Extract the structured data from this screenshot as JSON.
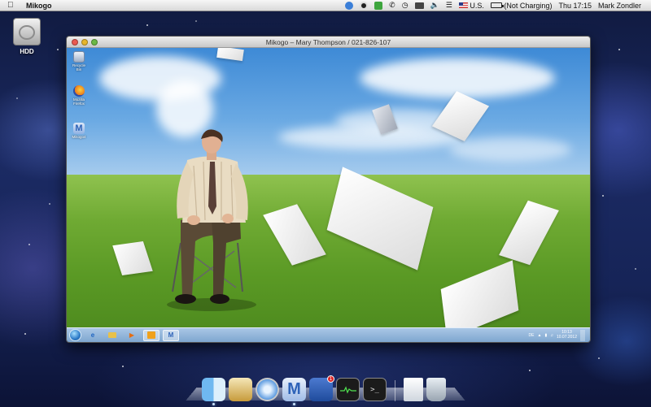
{
  "menubar": {
    "apple_icon": "apple-icon",
    "app_name": "Mikogo",
    "input_source": "U.S.",
    "battery_status": "(Not Charging)",
    "clock": "Thu 17:15",
    "user": "Mark Zondler",
    "status_icons": [
      "bluetooth-icon",
      "mikogo-status-icon",
      "evernote-icon",
      "phone-icon",
      "time-machine-icon",
      "display-icon",
      "volume-icon",
      "wifi-icon"
    ]
  },
  "desktop": {
    "hdd_label": "HDD"
  },
  "window": {
    "title": "Mikogo – Mary Thompson / 021-826-107"
  },
  "remote_desktop": {
    "icons": [
      {
        "label": "Recycle Bin",
        "icon": "recycle-bin-icon",
        "color": "#cfd8e6"
      },
      {
        "label": "Mozilla Firefox",
        "icon": "firefox-icon",
        "color": "#e8781c"
      },
      {
        "label": "Mikogo4",
        "icon": "mikogo-icon",
        "color": "#3f7fd2"
      }
    ],
    "taskbar": {
      "buttons": [
        "ie-icon",
        "explorer-icon",
        "media-player-icon",
        "outlook-icon",
        "mikogo-icon"
      ],
      "tray_lang": "DE",
      "time": "10:13",
      "date": "10.07.2012"
    }
  },
  "dock": {
    "items": [
      {
        "name": "finder",
        "icon": "finder-icon",
        "running": true
      },
      {
        "name": "preview",
        "icon": "preview-icon",
        "running": false
      },
      {
        "name": "safari",
        "icon": "safari-icon",
        "running": false
      },
      {
        "name": "mikogo",
        "icon": "mikogo-icon",
        "running": true
      },
      {
        "name": "xcode",
        "icon": "xcode-icon",
        "running": false,
        "badge": "1"
      },
      {
        "name": "activity-monitor",
        "icon": "activity-monitor-icon",
        "running": false
      },
      {
        "name": "terminal",
        "icon": "terminal-icon",
        "running": false
      },
      {
        "name": "documents-stack",
        "icon": "documents-stack-icon",
        "running": false
      },
      {
        "name": "trash",
        "icon": "trash-icon",
        "running": false
      }
    ]
  },
  "colors": {
    "accent": "#3f7fd2",
    "sky": "#5a9ddf",
    "grass": "#6faa33"
  }
}
